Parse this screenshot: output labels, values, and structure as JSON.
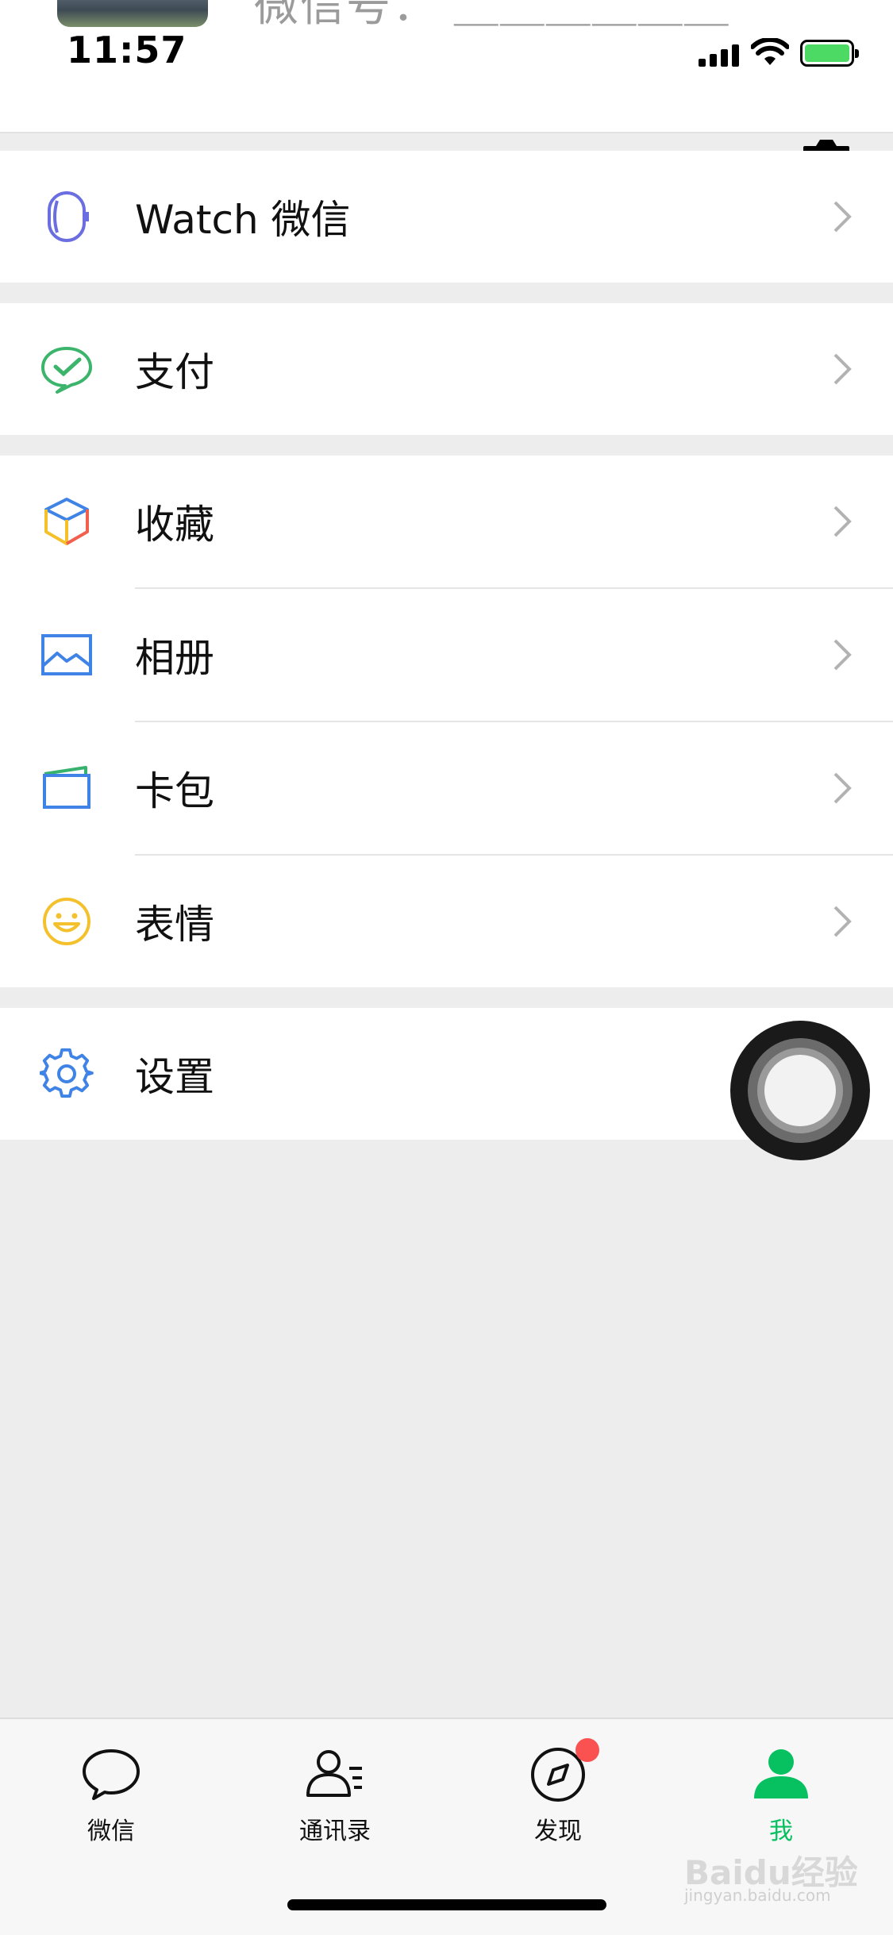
{
  "status_bar": {
    "time": "11:57",
    "ghost_text": "微信号：  ＿＿＿＿＿＿"
  },
  "menu": {
    "watch": "Watch 微信",
    "pay": "支付",
    "favorites": "收藏",
    "album": "相册",
    "cards": "卡包",
    "stickers": "表情",
    "settings": "设置"
  },
  "tabs": [
    {
      "label": "微信",
      "icon": "chat-bubble-icon",
      "active": false
    },
    {
      "label": "通讯录",
      "icon": "contacts-icon",
      "active": false
    },
    {
      "label": "发现",
      "icon": "compass-icon",
      "active": false,
      "badge": true
    },
    {
      "label": "我",
      "icon": "person-icon",
      "active": true
    }
  ],
  "watermark": {
    "text": "Baidu经验",
    "sub": "jingyan.baidu.com"
  },
  "colors": {
    "accent_green": "#07c160",
    "badge_red": "#fa5151",
    "icon_blue": "#3e83e5",
    "icon_yellow": "#f4c12d",
    "pay_green": "#3cb46c"
  }
}
